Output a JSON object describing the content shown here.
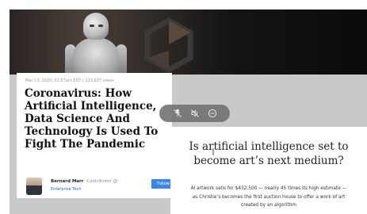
{
  "article": {
    "meta": "Mar 13, 2020, 01:57am EDT | 133,637 views",
    "headline": "Coronavirus: How Artificial Intelligence, Data Science And Technology Is Used To Fight The Pandemic",
    "author": {
      "name": "Bernard Marr",
      "role": "Contributor",
      "section": "Enterprise Tech"
    },
    "follow_label": "Follow"
  },
  "media_controls": {
    "icons": [
      "pin-off-icon",
      "volume-mute-icon",
      "minus-circle-icon"
    ]
  },
  "story": {
    "title": "Is artificial intelligence set to become art’s next medium?",
    "dek": "AI artwork sells for $432,500 — nearly 45 times its high estimate — as Christie’s becomes the first auction house to offer a work of art created by an algorithm"
  },
  "colors": {
    "follow_button": "#3c86e8",
    "section_link": "#2b66c4",
    "stage_bg": "#c9c9c9"
  }
}
